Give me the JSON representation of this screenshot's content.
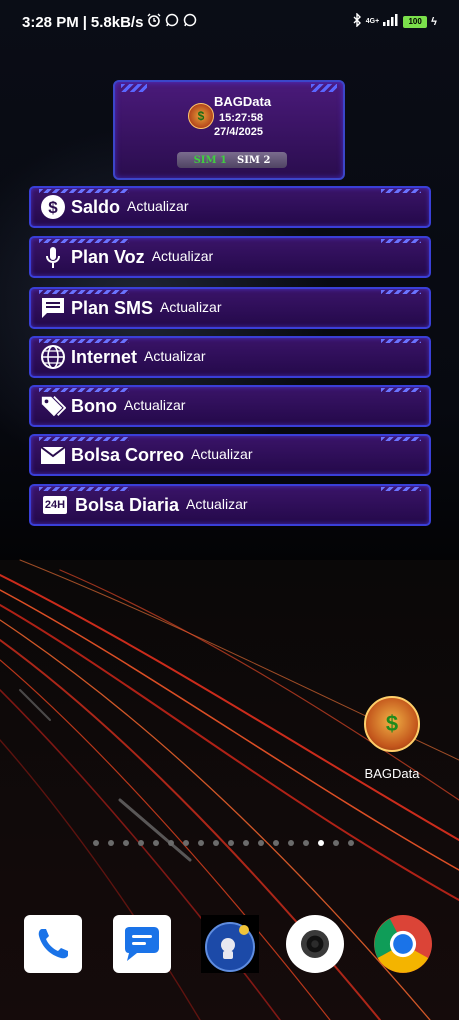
{
  "status_bar": {
    "time": "3:28 PM",
    "separator": "|",
    "speed": "5.8kB/s",
    "network": "4G+",
    "battery": "100"
  },
  "widget": {
    "title": "BAGData",
    "time": "15:27:58",
    "date": "27/4/2025",
    "sim1": "SIM 1",
    "sim2": "SIM 2"
  },
  "rows": [
    {
      "label": "Saldo",
      "action": "Actualizar",
      "icon": "dollar-circle-icon"
    },
    {
      "label": "Plan Voz",
      "action": "Actualizar",
      "icon": "microphone-icon"
    },
    {
      "label": "Plan SMS",
      "action": "Actualizar",
      "icon": "message-icon"
    },
    {
      "label": "Internet",
      "action": "Actualizar",
      "icon": "globe-icon"
    },
    {
      "label": "Bono",
      "action": "Actualizar",
      "icon": "tags-icon"
    },
    {
      "label": "Bolsa Correo",
      "action": "Actualizar",
      "icon": "mail-icon"
    },
    {
      "label": "Bolsa Diaria",
      "action": "Actualizar",
      "icon": "24h-icon",
      "icon_text": "24H"
    }
  ],
  "desktop_app": {
    "name": "BAGData",
    "icon": "money-bag-icon"
  },
  "pager": {
    "count": 18,
    "active_index": 15
  },
  "dock": [
    {
      "name": "phone",
      "icon": "phone-icon"
    },
    {
      "name": "messages",
      "icon": "messages-icon"
    },
    {
      "name": "astronaut-app",
      "icon": "astronaut-icon"
    },
    {
      "name": "camera",
      "icon": "camera-icon"
    },
    {
      "name": "chrome",
      "icon": "chrome-icon"
    }
  ],
  "colors": {
    "row_border": "#3a3fd8",
    "row_bg": "#2e0e5a",
    "accent_green": "#3fcf3f",
    "battery": "#7be04b",
    "light_trails": "#e0301e"
  }
}
